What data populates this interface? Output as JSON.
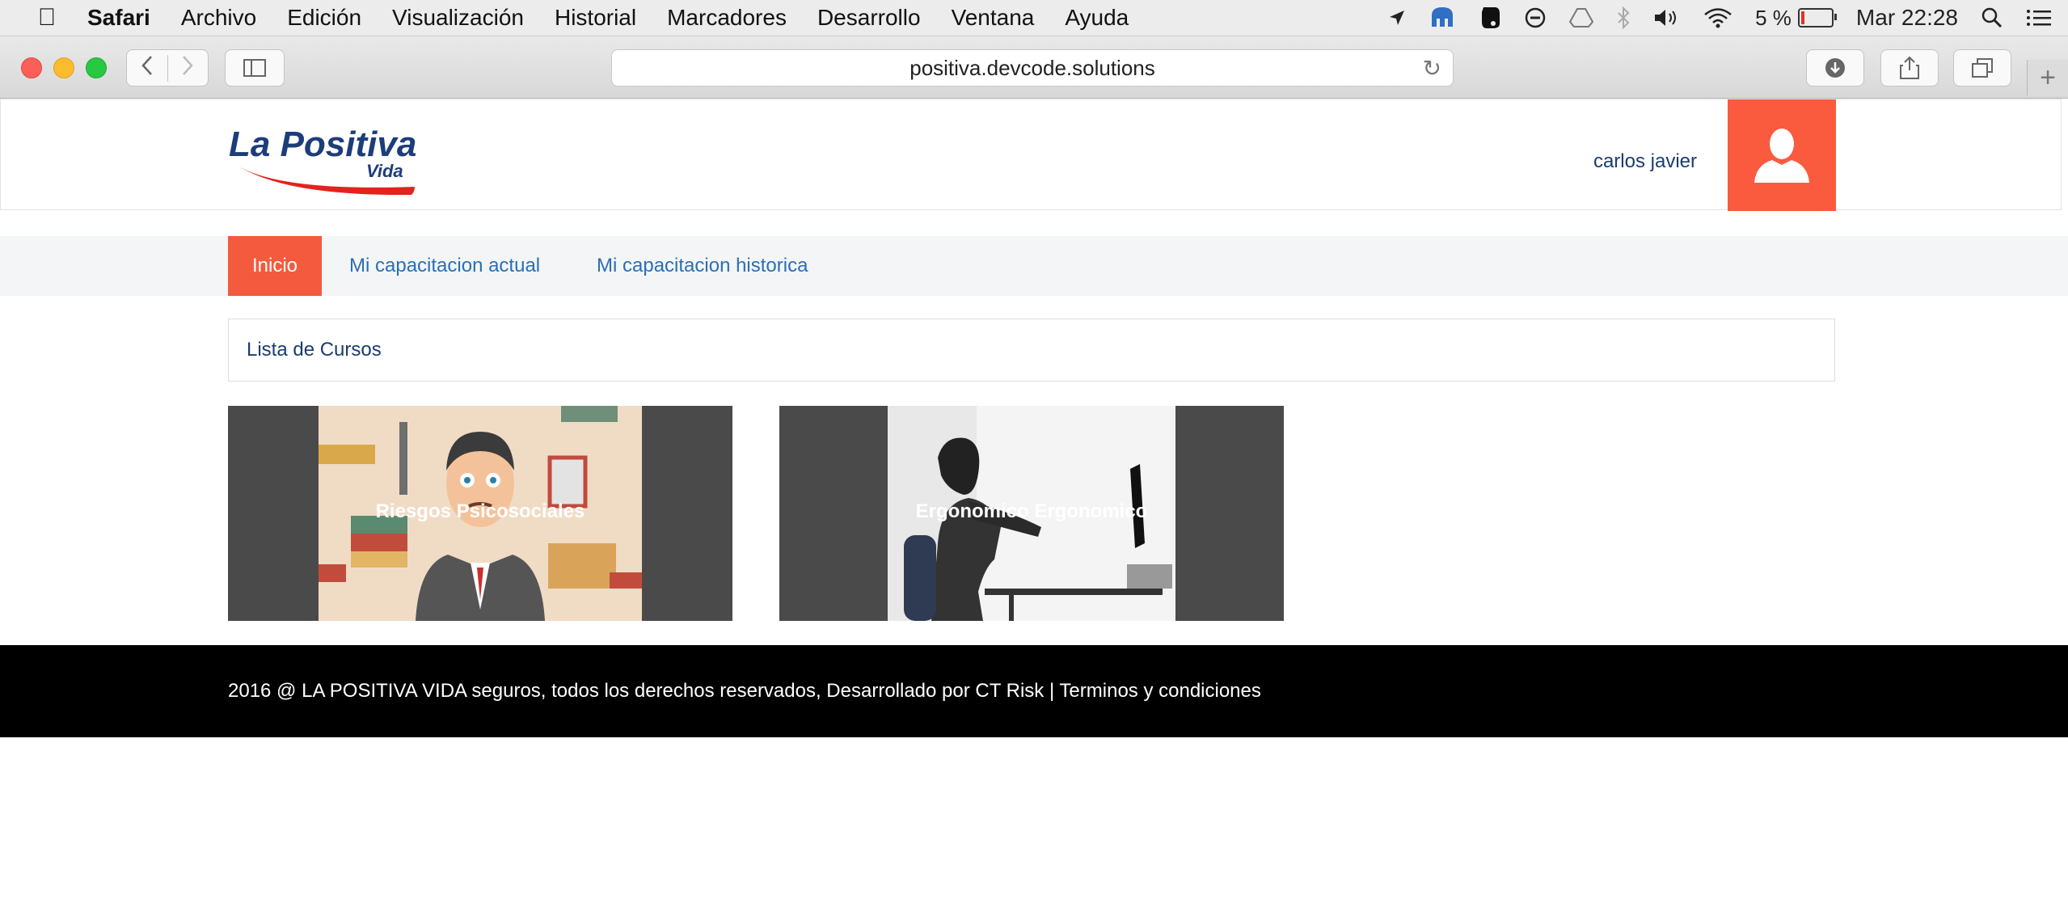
{
  "menubar": {
    "app": "Safari",
    "items": [
      "Archivo",
      "Edición",
      "Visualización",
      "Historial",
      "Marcadores",
      "Desarrollo",
      "Ventana",
      "Ayuda"
    ],
    "battery": "5 %",
    "clock": "Mar 22:28",
    "icons": [
      "apple-icon",
      "location-icon",
      "mammoth-icon",
      "evernote-icon",
      "minus-circle-icon",
      "drive-icon",
      "bluetooth-icon",
      "volume-icon",
      "wifi-icon",
      "battery-icon",
      "spotlight-icon",
      "list-icon"
    ]
  },
  "browser": {
    "url": "positiva.devcode.solutions"
  },
  "site": {
    "logo_main": "La Positiva",
    "logo_sub": "Vida",
    "username": "carlos javier",
    "nav": [
      "Inicio",
      "Mi capacitacion actual",
      "Mi capacitacion historica"
    ],
    "section_title": "Lista de Cursos",
    "courses": [
      {
        "title": "Riesgos Psicosociales"
      },
      {
        "title": "Ergonomico Ergonomico"
      }
    ],
    "footer": "2016 @ LA POSITIVA VIDA seguros, todos los derechos reservados, Desarrollado por CT Risk | Terminos y condiciones"
  },
  "colors": {
    "accent": "#f45a3d",
    "link": "#2a6fb5",
    "heading": "#1a3d6d",
    "footer_bg": "#000000"
  }
}
